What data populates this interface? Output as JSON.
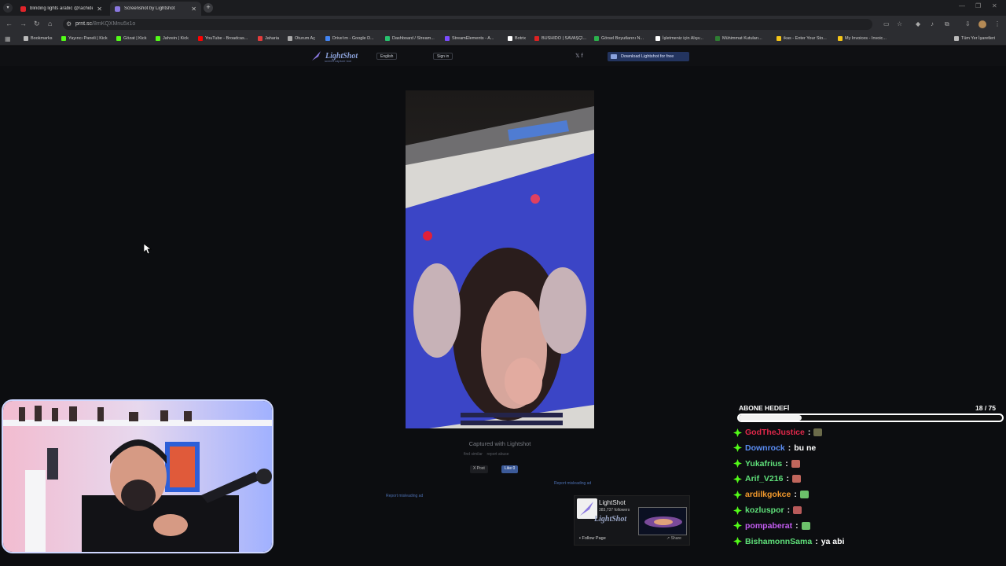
{
  "browser": {
    "tabs": [
      {
        "title": "blinding lights arabic @rachide",
        "favicon_color": "#e0242a",
        "active": false
      },
      {
        "title": "Screenshot by Lightshot",
        "favicon_color": "#8a78e0",
        "active": true
      }
    ],
    "new_tab_label": "+",
    "url_host": "prnt.sc",
    "url_path": "/8mKQXMnu5x1o",
    "bookmarks": [
      {
        "label": "Bookmarks",
        "icon_color": "#bbbbbb"
      },
      {
        "label": "Yayıncı Paneli | Kick",
        "icon_color": "#53fc18"
      },
      {
        "label": "Gözat | Kick",
        "icon_color": "#53fc18"
      },
      {
        "label": "Jahrein | Kick",
        "icon_color": "#53fc18"
      },
      {
        "label": "YouTube - Broadcas...",
        "icon_color": "#ff0000"
      },
      {
        "label": "Jaharia",
        "icon_color": "#e23c3c"
      },
      {
        "label": "Oturum Aç",
        "icon_color": "#aaaaaa"
      },
      {
        "label": "Drive'ım - Google D...",
        "icon_color": "#4285f4"
      },
      {
        "label": "Dashboard / Stream...",
        "icon_color": "#27c26e"
      },
      {
        "label": "StreamElements - A...",
        "icon_color": "#7b4cff"
      },
      {
        "label": "Botrix",
        "icon_color": "#ffffff"
      },
      {
        "label": "BUSHIDO | SAVAŞÇI...",
        "icon_color": "#d22"
      },
      {
        "label": "Görsel Boyutlarını N...",
        "icon_color": "#2bb24c"
      },
      {
        "label": "İşletmeniz için Alışv...",
        "icon_color": "#ffffff"
      },
      {
        "label": "Mühimmat Kutuları...",
        "icon_color": "#2e7d32"
      },
      {
        "label": "ikas - Enter Your Sto...",
        "icon_color": "#f5c518"
      },
      {
        "label": "My Invoices - Invoic...",
        "icon_color": "#f5c518"
      },
      {
        "label": "Tüm Yer İşaretleri",
        "icon_color": "#bbbbbb"
      }
    ]
  },
  "lightshot": {
    "logo_text": "LightShot",
    "logo_sub": "screen capture tool",
    "language": "English",
    "signin": "Sign in",
    "download": "Download Lightshot for free",
    "social": "𝕏  f",
    "captured": "Captured with Lightshot",
    "find_similar": "find similar",
    "report_abuse": "report abuse",
    "post": "X Post",
    "like": "Like 0",
    "report_ad_1": "Report misleading ad",
    "report_ad_2": "Report misleading ad",
    "fb_name": "LightShot",
    "fb_followers": "383,737 followers",
    "fb_follow": "Follow Page",
    "fb_share": "Share",
    "fb_logo": "LightShot"
  },
  "sub_goal": {
    "title": "ABONE HEDEFİ",
    "current": 18,
    "target": 75,
    "count_text": "18 / 75",
    "progress_fraction": 0.24
  },
  "chat": [
    {
      "user": "GodTheJustice",
      "color": "#e0284a",
      "message": "",
      "emote": "#6b6b4a"
    },
    {
      "user": "Downrock",
      "color": "#5b8ef5",
      "message": "bu ne",
      "emote": ""
    },
    {
      "user": "Yukafrius",
      "color": "#5fe07a",
      "message": "",
      "emote": "#c0665c"
    },
    {
      "user": "Arif_V216",
      "color": "#5fe07a",
      "message": "",
      "emote": "#c0665c"
    },
    {
      "user": "ardilkgokce",
      "color": "#f39a2c",
      "message": "",
      "emote": "#6cc06a"
    },
    {
      "user": "kozluspor",
      "color": "#5fe07a",
      "message": "",
      "emote": "#b85a5a"
    },
    {
      "user": "pompaberat",
      "color": "#c35cf0",
      "message": "",
      "emote": "#6cc06a"
    },
    {
      "user": "BishamonnSama",
      "color": "#5fe07a",
      "message": "ya abi",
      "emote": ""
    }
  ]
}
